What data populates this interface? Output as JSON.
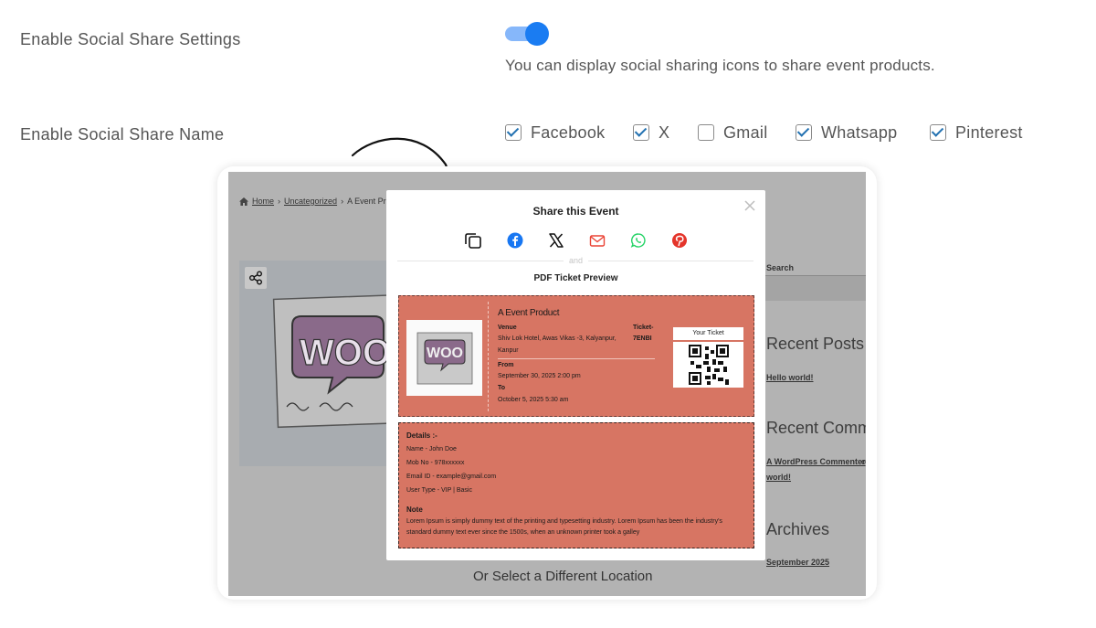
{
  "settings": {
    "social_share": {
      "label": "Enable Social Share Settings",
      "enabled": true,
      "help_text": "You can display social sharing icons to share event products."
    },
    "share_names": {
      "label": "Enable Social Share Name",
      "options": [
        {
          "label": "Facebook",
          "checked": true
        },
        {
          "label": "X",
          "checked": true
        },
        {
          "label": "Gmail",
          "checked": false
        },
        {
          "label": "Whatsapp",
          "checked": true
        },
        {
          "label": "Pinterest",
          "checked": true
        }
      ]
    }
  },
  "preview": {
    "breadcrumb": {
      "home": "Home",
      "category": "Uncategorized",
      "current": "A Event Pr"
    },
    "sidebar": {
      "search_label": "Search",
      "recent_posts": "Recent Posts",
      "recent_post_link": "Hello world!",
      "recent_comments": "Recent Comm",
      "comment_author": "A WordPress Commenter",
      "comment_on": "o",
      "comment_post": "world!",
      "archives": "Archives",
      "archive_link": "September 2025"
    },
    "bottom_text": "Or Select a Different Location",
    "modal": {
      "title": "Share this Event",
      "share_icons": [
        "copy-icon",
        "facebook-icon",
        "x-icon",
        "gmail-icon",
        "whatsapp-icon",
        "pinterest-icon"
      ],
      "divider_text": "and",
      "pdf_title": "PDF Ticket Preview",
      "ticket": {
        "event_name": "A Event Product",
        "venue_label": "Venue",
        "venue_line1": "Shiv Lok Hotel, Awas Vikas -3, Kalyanpur,",
        "venue_line2": "Kanpur",
        "ticket_label": "Ticket-",
        "ticket_code": "7ENBI",
        "from_label": "From",
        "from_value": "September 30, 2025 2:00 pm",
        "to_label": "To",
        "to_value": "October 5, 2025 5:30 am",
        "badge": "Your Ticket"
      },
      "details": {
        "heading": "Details :-",
        "lines": [
          "Name - John Doe",
          "Mob No - 978xxxxxx",
          "Email ID - example@gmail.com",
          "User Type - VIP | Basic"
        ],
        "note_heading": "Note",
        "note_text": "Lorem Ipsum is simply dummy text of the printing and typesetting industry. Lorem Ipsum has been the industry's standard dummy text ever since the 1500s, when an unknown printer took a galley"
      }
    }
  },
  "colors": {
    "toggle_on": "#1a7cf2",
    "ticket_bg": "#d77563",
    "facebook": "#1877f2",
    "gmail": "#ea4335",
    "whatsapp": "#25d366",
    "pinterest": "#e60023"
  }
}
